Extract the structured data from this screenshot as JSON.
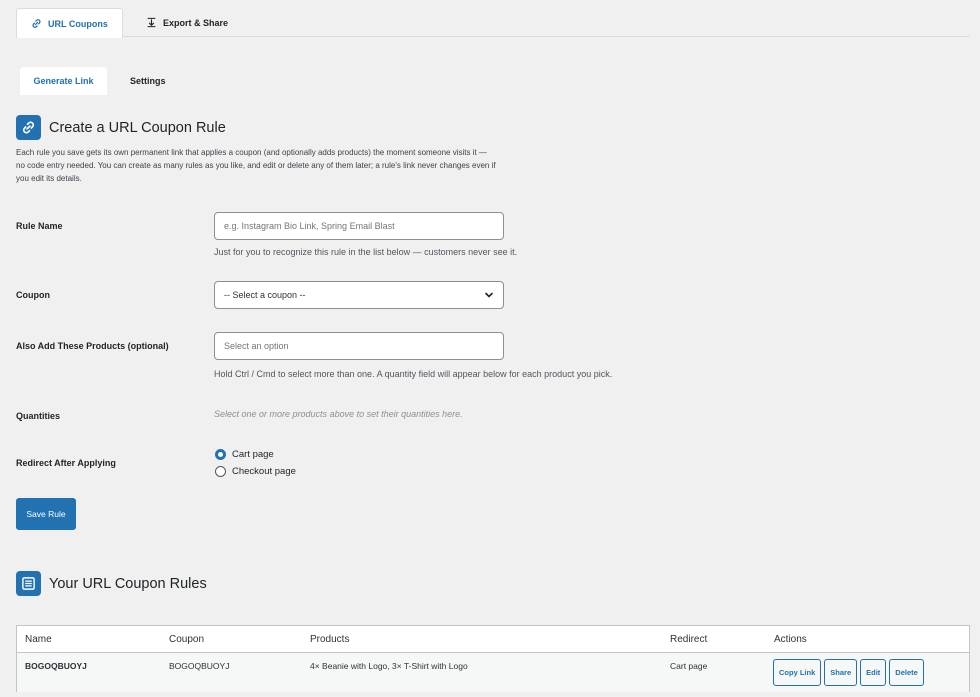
{
  "top_tabs": [
    {
      "label": "URL Coupons",
      "icon": "link-icon",
      "active": true
    },
    {
      "label": "Export & Share",
      "icon": "download-icon",
      "active": false
    }
  ],
  "sub_tabs": [
    {
      "label": "Generate Link",
      "active": true
    },
    {
      "label": "Settings",
      "active": false
    }
  ],
  "create_section": {
    "title": "Create a URL Coupon Rule",
    "description": "Each rule you save gets its own permanent link that applies a coupon (and optionally adds products) the moment someone visits it — no code entry needed. You can create as many rules as you like, and edit or delete any of them later; a rule's link never changes even if you edit its details."
  },
  "form": {
    "rule_name": {
      "label": "Rule Name",
      "placeholder": "e.g. Instagram Bio Link, Spring Email Blast",
      "help": "Just for you to recognize this rule in the list below — customers never see it."
    },
    "coupon": {
      "label": "Coupon",
      "selected": "-- Select a coupon --"
    },
    "products": {
      "label": "Also Add These Products (optional)",
      "placeholder": "Select an option",
      "help": "Hold Ctrl / Cmd to select more than one. A quantity field will appear below for each product you pick."
    },
    "quantities": {
      "label": "Quantities",
      "help": "Select one or more products above to set their quantities here."
    },
    "redirect": {
      "label": "Redirect After Applying",
      "options": [
        {
          "label": "Cart page",
          "checked": true
        },
        {
          "label": "Checkout page",
          "checked": false
        }
      ]
    },
    "save_label": "Save Rule"
  },
  "rules_section": {
    "title": "Your URL Coupon Rules",
    "columns": [
      "Name",
      "Coupon",
      "Products",
      "Redirect",
      "Actions"
    ],
    "rows": [
      {
        "name": "BOGOQBUOYJ",
        "coupon": "BOGOQBUOYJ",
        "products": "4× Beanie with Logo, 3× T-Shirt with Logo",
        "redirect": "Cart page",
        "actions": [
          "Copy Link",
          "Share",
          "Edit",
          "Delete"
        ]
      }
    ]
  },
  "colors": {
    "accent": "#2271b1",
    "background": "#f0f0f1"
  }
}
